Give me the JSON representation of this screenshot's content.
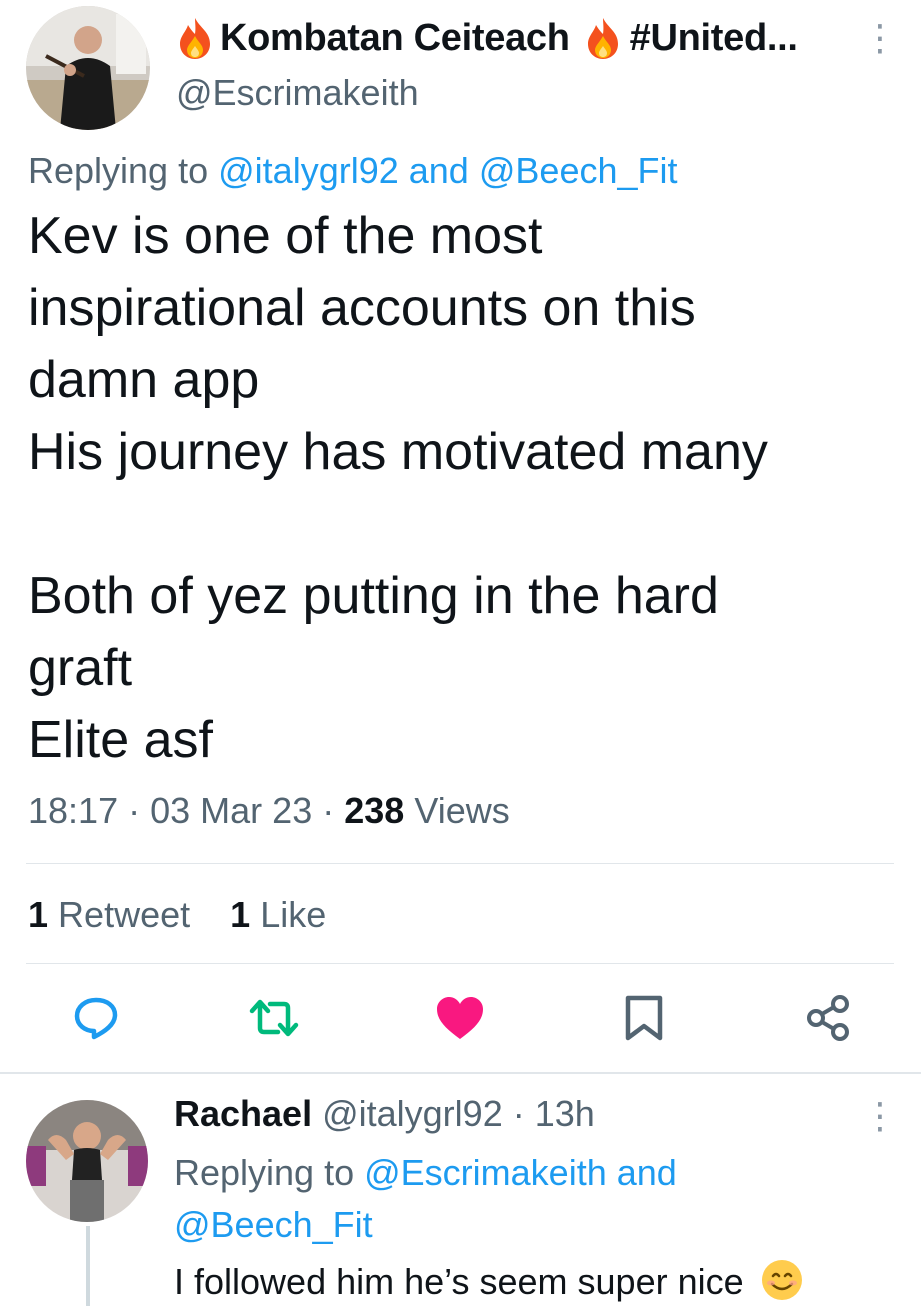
{
  "tweet": {
    "display_name": "Kombatan Ceiteach",
    "name_suffix": "#United...",
    "handle": "@Escrimakeith",
    "replying_prefix": "Replying to",
    "replying_to_1": "@italygrl92",
    "replying_and": "and",
    "replying_to_2": "@Beech_Fit",
    "text": "Kev is one of the most\ninspirational accounts on this\ndamn app\nHis journey has motivated many\n\nBoth of yez putting in the hard\ngraft\nElite asf",
    "time": "18:17",
    "date": "03 Mar 23",
    "views_count": "238",
    "views_label": "Views",
    "retweet_count": "1",
    "retweet_label": "Retweet",
    "like_count": "1",
    "like_label": "Like",
    "dot": "·",
    "more_icon": "⋮"
  },
  "actions": {
    "reply_icon": "reply-icon",
    "retweet_icon": "retweet-icon",
    "like_icon": "heart-icon",
    "bookmark_icon": "bookmark-icon",
    "share_icon": "share-icon"
  },
  "reply": {
    "display_name": "Rachael",
    "handle": "@italygrl92",
    "dot": "·",
    "time_ago": "13h",
    "replying_prefix": "Replying to",
    "replying_to_1": "@Escrimakeith",
    "replying_and": "and",
    "replying_to_2": "@Beech_Fit",
    "text": "I followed him he’s seem super nice",
    "more_icon": "⋮"
  },
  "colors": {
    "link": "#1d9bf0",
    "secondary_text": "#536471",
    "like_active": "#f91880",
    "retweet": "#00ba7c",
    "reply_icon": "#1d9bf0"
  }
}
